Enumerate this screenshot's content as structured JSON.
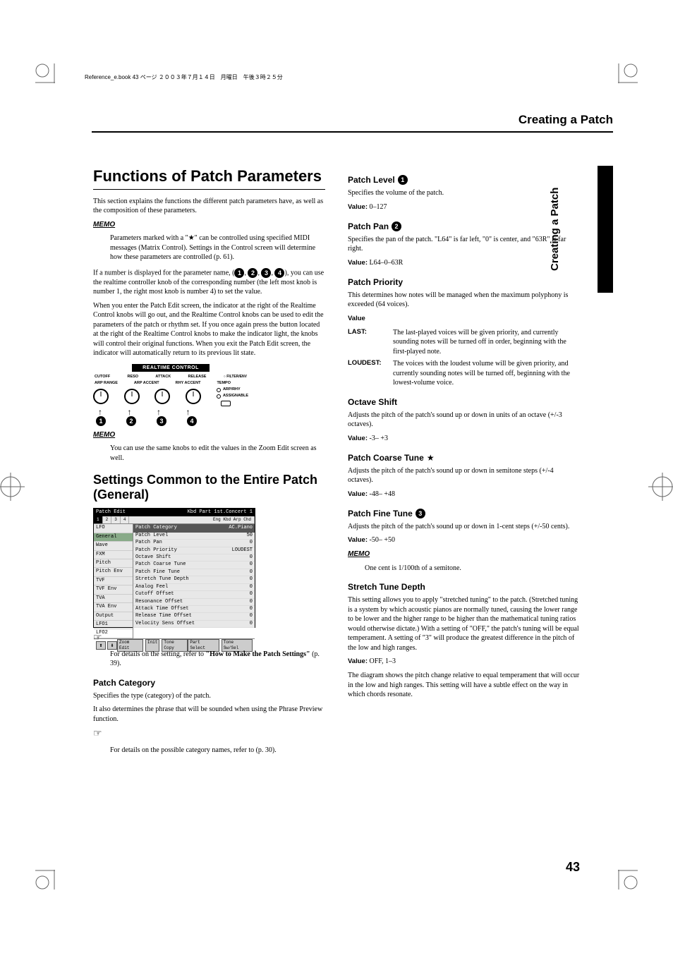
{
  "meta": {
    "headerLine": "Reference_e.book 43 ページ ２００３年７月１４日　月曜日　午後３時２５分",
    "runningTitle": "Creating a Patch",
    "sideTab": "Creating a Patch",
    "pageNumber": "43"
  },
  "left": {
    "h1": "Functions of Patch Parameters",
    "intro": "This section explains the functions the different patch parameters have, as well as the composition of these parameters.",
    "memo1": "Parameters marked with a \"★\" can be controlled using specified MIDI messages (Matrix Control). Settings in the Control screen will determine how these parameters are controlled (p. 61).",
    "numPara1_a": "If a number is displayed for the parameter name, (",
    "numPara1_b": "), you can use the realtime controller knob of the corresponding number (the left most knob is number 1, the right most knob is number 4) to set the value.",
    "numPara2": "When you enter the Patch Edit screen, the indicator at the right of the Realtime Control knobs will go out, and the Realtime Control knobs can be used to edit the parameters of the patch or rhythm set. If you once again press the button located at the right of the Realtime Control knobs to make the indicator light, the knobs will control their original functions. When you exit the Patch Edit screen, the indicator will automatically return to its previous lit state.",
    "knob": {
      "title": "REALTIME CONTROL",
      "top": [
        "CUTOFF",
        "RESO",
        "ATTACK",
        "RELEASE",
        "FILTER/ENV"
      ],
      "row2": [
        "ARP RANGE",
        "ARP ACCENT",
        "RHY ACCENT",
        "TEMPO"
      ],
      "leds": [
        "FILTER/ENV",
        "ARP/RHY",
        "ASSIGNABLE"
      ]
    },
    "memo2": "You can use the same knobs to edit the values in the Zoom Edit screen as well.",
    "h2": "Settings Common to the Entire Patch (General)",
    "screenshot": {
      "title": "Patch Edit",
      "titleRight": "Kbd Part  1st.Concert  1",
      "tabs": [
        "1",
        "2",
        "3",
        "4"
      ],
      "tabRight": "Eng Kbd Arp Chd",
      "sideItems": [
        "LFO",
        "General",
        "Wave",
        "FXM",
        "Pitch",
        "Pitch Env",
        "TVF",
        "TVF Env",
        "TVA",
        "TVA Env",
        "Output",
        "LFO1",
        "LFO2"
      ],
      "selectedSideItem": "General",
      "catHeader": "Patch Category",
      "catValue": "AC.Piano",
      "rows": [
        {
          "k": "Patch Level",
          "v": "50"
        },
        {
          "k": "Patch Pan",
          "v": "0"
        },
        {
          "k": "Patch Priority",
          "v": "LOUDEST"
        },
        {
          "k": "Octave Shift",
          "v": "0"
        },
        {
          "k": "Patch Coarse Tune",
          "v": "0"
        },
        {
          "k": "Patch Fine Tune",
          "v": "0"
        },
        {
          "k": "Stretch Tune Depth",
          "v": "0"
        },
        {
          "k": "Analog Feel",
          "v": "0"
        },
        {
          "k": "Cutoff Offset",
          "v": "0"
        },
        {
          "k": "Resonance Offset",
          "v": "0"
        },
        {
          "k": "Attack Time Offset",
          "v": "0"
        },
        {
          "k": "Release Time Offset",
          "v": "0"
        },
        {
          "k": "Velocity Sens Offset",
          "v": "0"
        }
      ],
      "footer": {
        "up": "⬆",
        "down": "⬇",
        "btns": [
          "Zoom Edit",
          "Init",
          "Tone Copy"
        ],
        "right": [
          "Part Select",
          "Tone Sw/Sel"
        ]
      }
    },
    "pointer1_a": "For details on the setting, refer to ",
    "pointer1_b": "\"How to Make the Patch Settings\"",
    "pointer1_c": " (p. 39).",
    "patchCategory": {
      "title": "Patch Category",
      "p1": "Specifies the type (category) of the patch.",
      "p2": "It also determines the phrase that will be sounded when using the Phrase Preview function.",
      "pointer": "For details on the possible category names, refer to (p. 30)."
    }
  },
  "right": {
    "patchLevel": {
      "title": "Patch Level",
      "desc": "Specifies the volume of the patch.",
      "value": "0–127"
    },
    "patchPan": {
      "title": "Patch Pan",
      "desc": "Specifies the pan of the patch. \"L64\" is far left, \"0\" is center, and \"63R\" is far right.",
      "value": "L64–0–63R"
    },
    "patchPriority": {
      "title": "Patch Priority",
      "desc": "This determines how notes will be managed when the maximum polyphony is exceeded (64 voices).",
      "valueLabel": "Value",
      "rows": [
        {
          "term": "LAST:",
          "def": "The last-played voices will be given priority, and currently sounding notes will be turned off in order, beginning with the first-played note."
        },
        {
          "term": "LOUDEST:",
          "def": "The voices with the loudest volume will be given priority, and currently sounding notes will be turned off, beginning with the lowest-volume voice."
        }
      ]
    },
    "octaveShift": {
      "title": "Octave Shift",
      "desc": "Adjusts the pitch of the patch's sound up or down in units of an octave (+/-3 octaves).",
      "value": "-3– +3"
    },
    "patchCoarseTune": {
      "title": "Patch Coarse Tune",
      "star": "★",
      "desc": "Adjusts the pitch of the patch's sound up or down in semitone steps (+/-4 octaves).",
      "value": "-48– +48"
    },
    "patchFineTune": {
      "title": "Patch Fine Tune",
      "desc": "Adjusts the pitch of the patch's sound up or down in 1-cent steps (+/-50 cents).",
      "value": "-50– +50",
      "memo": "One cent is 1/100th of a semitone."
    },
    "stretchTune": {
      "title": "Stretch Tune Depth",
      "desc": "This setting allows you to apply \"stretched tuning\" to the patch. (Stretched tuning is a system by which acoustic pianos are normally tuned, causing the lower range to be lower and the higher range to be higher than the mathematical tuning ratios would otherwise dictate.) With a setting of \"OFF,\" the patch's tuning will be equal temperament. A setting of \"3\" will produce the greatest difference in the pitch of the low and high ranges.",
      "value": "OFF, 1–3",
      "after": "The diagram shows the pitch change relative to equal temperament that will occur in the low and high ranges. This setting will have a subtle effect on the way in which chords resonate."
    },
    "valueLabel": "Value:"
  }
}
